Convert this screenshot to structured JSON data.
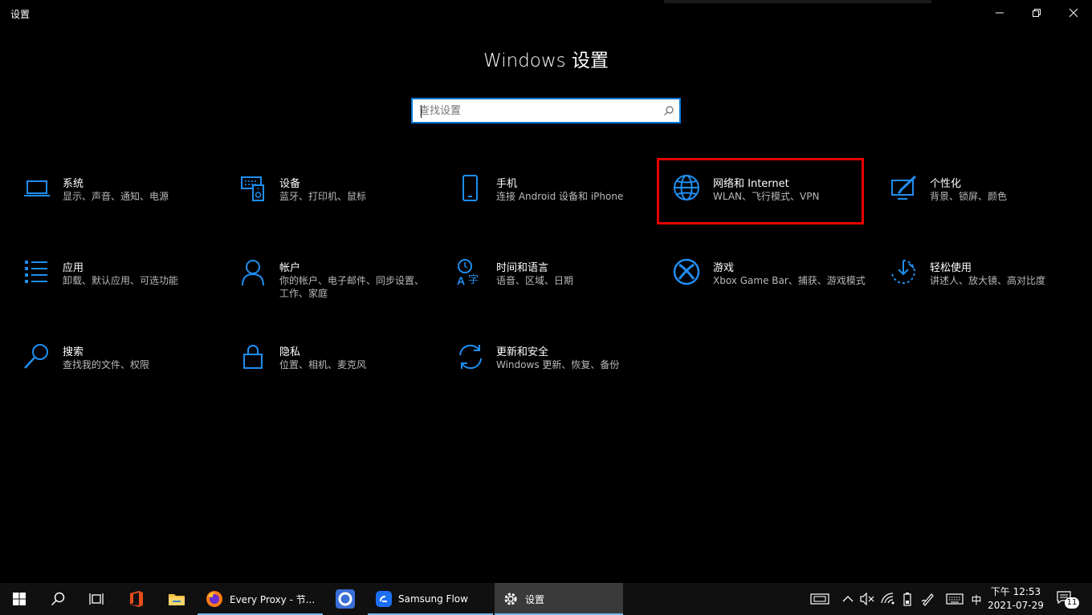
{
  "window": {
    "title": "设置"
  },
  "header": {
    "title": "Windows 设置"
  },
  "search": {
    "placeholder": "查找设置",
    "value": ""
  },
  "tiles": [
    {
      "name": "系统",
      "desc": "显示、声音、通知、电源",
      "icon": "laptop-icon"
    },
    {
      "name": "设备",
      "desc": "蓝牙、打印机、鼠标",
      "icon": "devices-icon"
    },
    {
      "name": "手机",
      "desc": "连接 Android 设备和 iPhone",
      "icon": "phone-icon"
    },
    {
      "name": "网络和 Internet",
      "desc": "WLAN、飞行模式、VPN",
      "icon": "globe-icon"
    },
    {
      "name": "个性化",
      "desc": "背景、锁屏、颜色",
      "icon": "personalization-icon"
    },
    {
      "name": "应用",
      "desc": "卸载、默认应用、可选功能",
      "icon": "apps-list-icon"
    },
    {
      "name": "帐户",
      "desc": "你的帐户、电子邮件、同步设置、工作、家庭",
      "icon": "person-icon"
    },
    {
      "name": "时间和语言",
      "desc": "语音、区域、日期",
      "icon": "time-language-icon"
    },
    {
      "name": "游戏",
      "desc": "Xbox Game Bar、捕获、游戏模式",
      "icon": "xbox-icon"
    },
    {
      "name": "轻松使用",
      "desc": "讲述人、放大镜、高对比度",
      "icon": "ease-of-access-icon"
    },
    {
      "name": "搜索",
      "desc": "查找我的文件、权限",
      "icon": "search-icon"
    },
    {
      "name": "隐私",
      "desc": "位置、相机、麦克风",
      "icon": "lock-icon"
    },
    {
      "name": "更新和安全",
      "desc": "Windows 更新、恢复、备份",
      "icon": "sync-icon"
    }
  ],
  "taskbar": {
    "apps": [
      {
        "label": "Every Proxy - 节...",
        "icon": "firefox-icon"
      },
      {
        "label": "Samsung Flow",
        "icon": "samsung-flow-icon"
      },
      {
        "label": "设置",
        "icon": "gear-icon"
      }
    ],
    "ime": "中",
    "time": "下午 12:53",
    "date": "2021-07-29",
    "notification_count": "11"
  },
  "colors": {
    "accent": "#0078d7",
    "icon_blue": "#1f8ef1",
    "highlight_red": "#e60000"
  }
}
